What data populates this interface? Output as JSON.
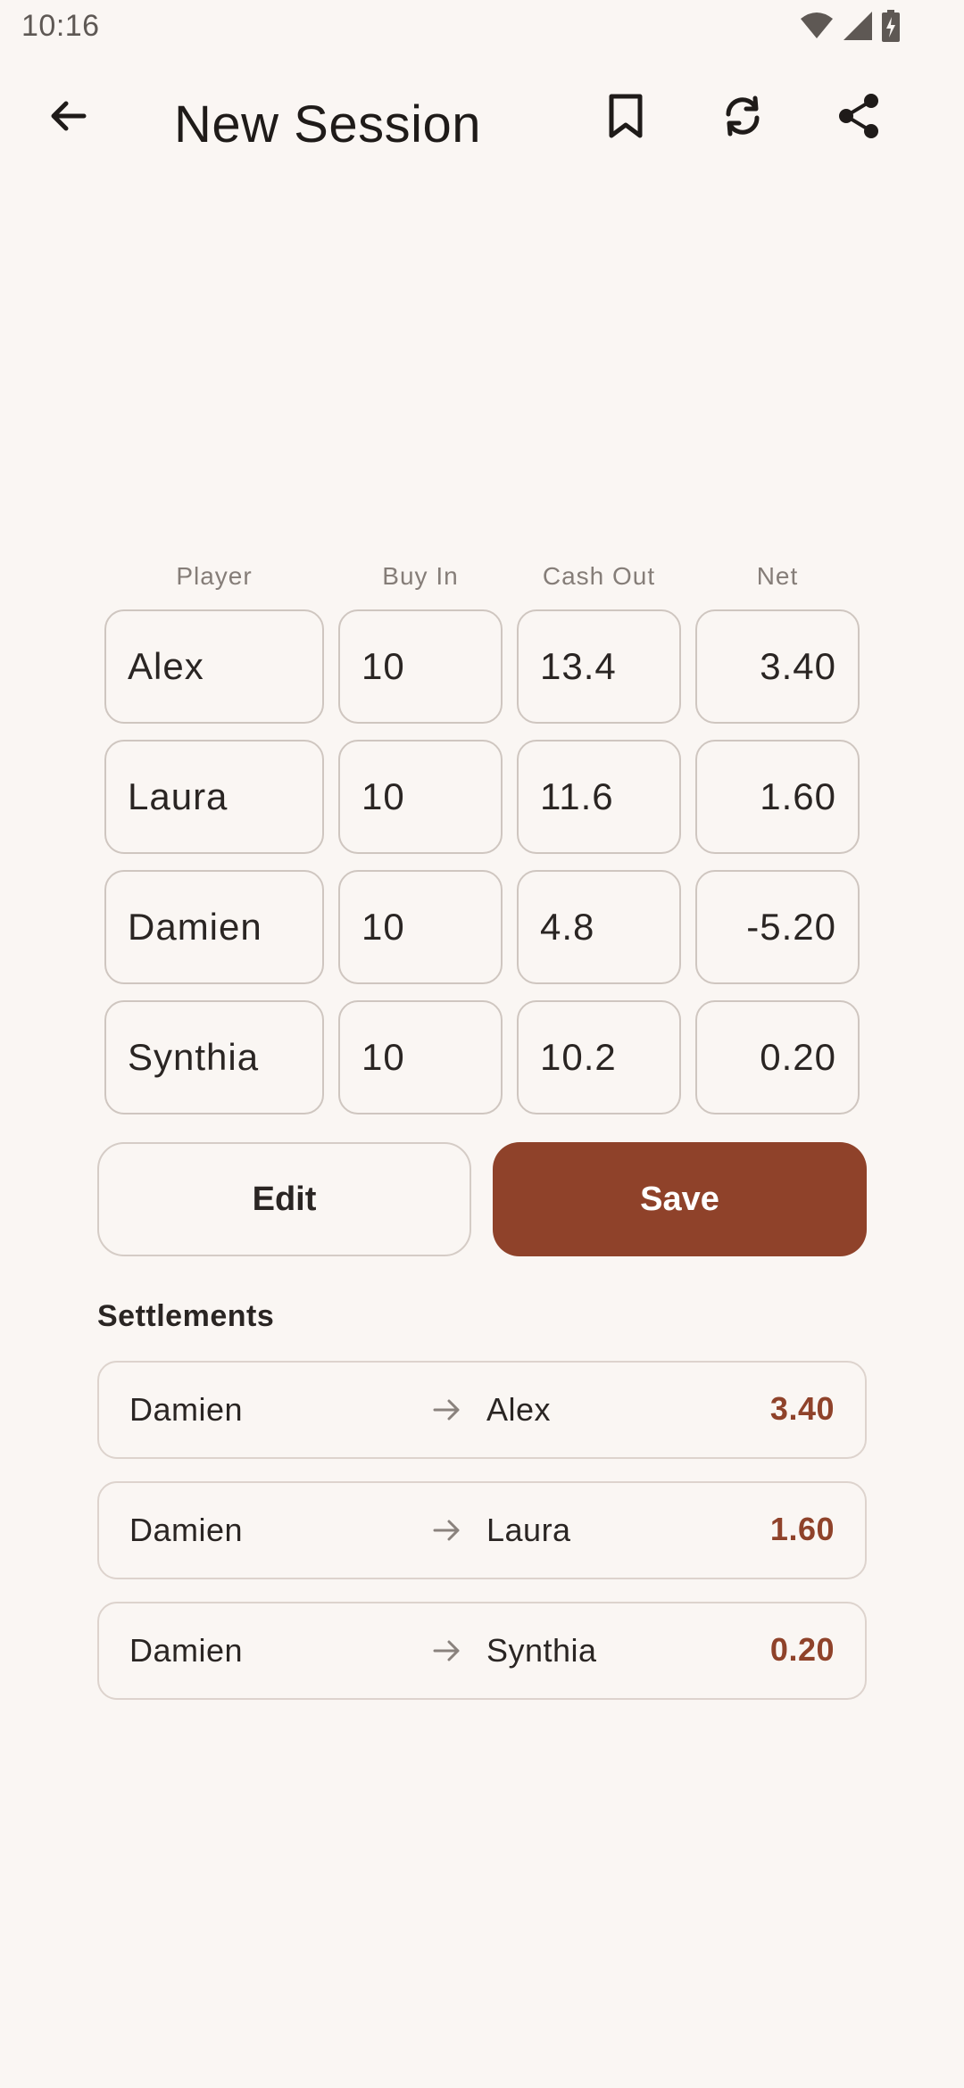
{
  "status_bar": {
    "time": "10:16",
    "icons": [
      "wifi-icon",
      "cell-signal-icon",
      "battery-charging-icon"
    ]
  },
  "app_bar": {
    "title": "New Session",
    "icons": [
      "back-arrow-icon",
      "bookmark-icon",
      "refresh-icon",
      "share-icon"
    ]
  },
  "table": {
    "headers": {
      "player": "Player",
      "buy_in": "Buy In",
      "cash_out": "Cash Out",
      "net": "Net"
    },
    "rows": [
      {
        "player": "Alex",
        "buy_in": "10",
        "cash_out": "13.4",
        "net": "3.40"
      },
      {
        "player": "Laura",
        "buy_in": "10",
        "cash_out": "11.6",
        "net": "1.60"
      },
      {
        "player": "Damien",
        "buy_in": "10",
        "cash_out": "4.8",
        "net": "-5.20"
      },
      {
        "player": "Synthia",
        "buy_in": "10",
        "cash_out": "10.2",
        "net": "0.20"
      }
    ]
  },
  "actions": {
    "edit_label": "Edit",
    "save_label": "Save"
  },
  "settlements": {
    "title": "Settlements",
    "items": [
      {
        "from": "Damien",
        "to": "Alex",
        "amount": "3.40"
      },
      {
        "from": "Damien",
        "to": "Laura",
        "amount": "1.60"
      },
      {
        "from": "Damien",
        "to": "Synthia",
        "amount": "0.20"
      }
    ]
  },
  "colors": {
    "background": "#faf6f3",
    "accent": "#8f422a",
    "border": "#cfc6c0"
  }
}
